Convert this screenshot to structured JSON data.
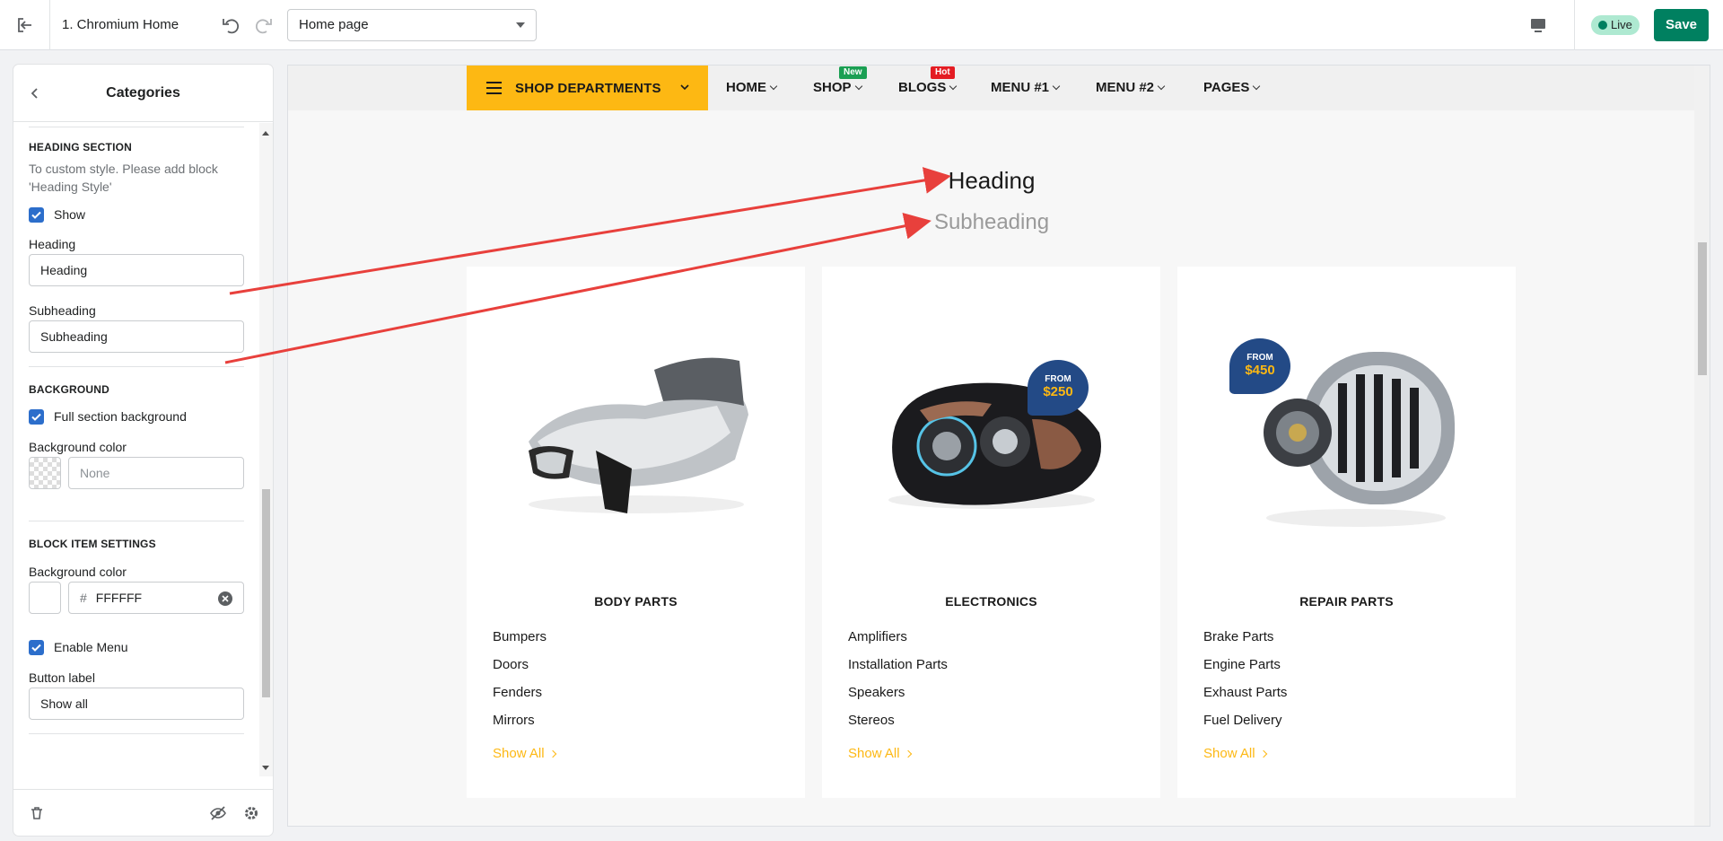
{
  "topbar": {
    "theme_name": "1. Chromium Home",
    "page_select": "Home page",
    "live_label": "Live",
    "save_label": "Save"
  },
  "sidebar": {
    "title": "Categories",
    "heading_section": {
      "title": "HEADING SECTION",
      "help": "To custom style. Please add block 'Heading Style'",
      "show_label": "Show",
      "show_checked": true,
      "heading_label": "Heading",
      "heading_value": "Heading",
      "subheading_label": "Subheading",
      "subheading_value": "Subheading"
    },
    "background": {
      "title": "BACKGROUND",
      "full_label": "Full section background",
      "full_checked": true,
      "color_label": "Background color",
      "color_placeholder": "None"
    },
    "block_item": {
      "title": "BLOCK ITEM SETTINGS",
      "color_label": "Background color",
      "hash": "#",
      "color_value": "FFFFFF",
      "enable_menu_label": "Enable Menu",
      "enable_menu_checked": true,
      "button_label": "Button label",
      "button_value": "Show all"
    }
  },
  "preview": {
    "shop_departments": "SHOP DEPARTMENTS",
    "nav": [
      {
        "label": "HOME"
      },
      {
        "label": "SHOP",
        "tag": "New"
      },
      {
        "label": "BLOGS",
        "tag": "Hot"
      },
      {
        "label": "MENU #1"
      },
      {
        "label": "MENU #2"
      },
      {
        "label": "PAGES"
      }
    ],
    "heading": "Heading",
    "subheading": "Subheading",
    "cards": [
      {
        "name": "BODY PARTS",
        "links": [
          "Bumpers",
          "Doors",
          "Fenders",
          "Mirrors"
        ],
        "show_all": "Show All"
      },
      {
        "name": "ELECTRONICS",
        "links": [
          "Amplifiers",
          "Installation Parts",
          "Speakers",
          "Stereos"
        ],
        "show_all": "Show All",
        "price_from": "FROM",
        "price": "$250"
      },
      {
        "name": "REPAIR PARTS",
        "links": [
          "Brake Parts",
          "Engine Parts",
          "Exhaust Parts",
          "Fuel Delivery"
        ],
        "show_all": "Show All",
        "price_from": "FROM",
        "price": "$450"
      }
    ]
  },
  "colors": {
    "save_green": "#008060",
    "checkbox_blue": "#2c6ecb",
    "shop_yellow": "#fdb813",
    "tag_new": "#1a9f53",
    "tag_hot": "#e41c23",
    "annotation_arrow": "#e8403c"
  },
  "icons": [
    "exit-icon",
    "undo-icon",
    "redo-icon",
    "desktop-icon",
    "back-icon",
    "trash-icon",
    "eye-off-icon",
    "gear-icon"
  ]
}
